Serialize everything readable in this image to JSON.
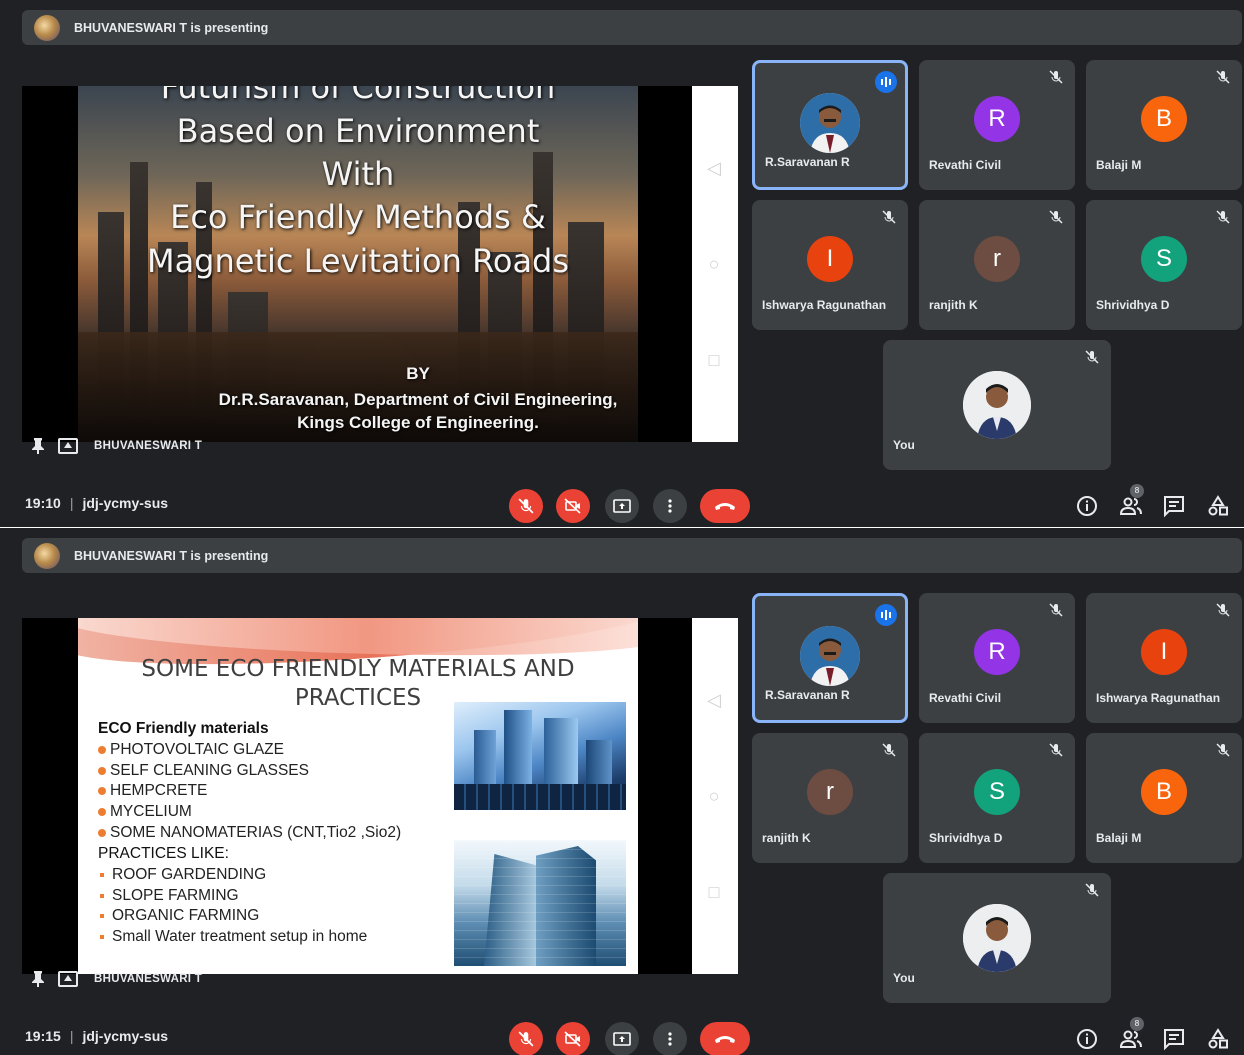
{
  "colors": {
    "accent": "#8ab4f8",
    "danger": "#ea4335",
    "tile_bg": "#3c4043",
    "bg": "#202124",
    "bullet": "#ed7d31"
  },
  "meetings": [
    {
      "presenter_banner": "BHUVANESWARI T is presenting",
      "stage_name": "BHUVANESWARI T",
      "time": "19:10",
      "meeting_code": "jdj-ycmy-sus",
      "people_count": "8",
      "slide": {
        "title_lines": [
          "Futurism of Construction",
          "Based on Environment",
          "With",
          "Eco Friendly Methods &",
          "Magnetic Levitation Roads"
        ],
        "by": "BY",
        "author": "Dr.R.Saravanan, Department of Civil Engineering,",
        "college": "Kings College of Engineering."
      },
      "participants": [
        {
          "name": "R.Saravanan R",
          "initial": "",
          "color": "",
          "icon": "photo-avatar",
          "speaking": true
        },
        {
          "name": "Revathi Civil",
          "initial": "R",
          "color": "#9334e6",
          "icon": "mic-off-icon"
        },
        {
          "name": "Balaji M",
          "initial": "B",
          "color": "#f9650c",
          "icon": "mic-off-icon"
        },
        {
          "name": "Ishwarya Ragunathan",
          "initial": "I",
          "color": "#e8430f",
          "icon": "mic-off-icon"
        },
        {
          "name": "ranjith K",
          "initial": "r",
          "color": "#6d4c41",
          "icon": "mic-off-icon"
        },
        {
          "name": "Shrividhya D",
          "initial": "S",
          "color": "#12a37c",
          "icon": "mic-off-icon"
        }
      ],
      "self": {
        "name": "You",
        "icon": "mic-off-icon"
      }
    },
    {
      "presenter_banner": "BHUVANESWARI T is presenting",
      "stage_name": "BHUVANESWARI T",
      "time": "19:15",
      "meeting_code": "jdj-ycmy-sus",
      "people_count": "8",
      "slide": {
        "title_line1": "SOME ECO FRIENDLY MATERIALS AND",
        "title_line2": "PRACTICES",
        "materials_heading": "ECO Friendly materials",
        "materials": [
          "PHOTOVOLTAIC GLAZE",
          "SELF CLEANING GLASSES",
          "HEMPCRETE",
          "MYCELIUM",
          "SOME NANOMATERIAS (CNT,Tio2 ,Sio2)"
        ],
        "practices_heading": "PRACTICES LIKE:",
        "practices": [
          "ROOF GARDENDING",
          "SLOPE FARMING",
          "ORGANIC FARMING",
          "Small Water treatment setup in home"
        ]
      },
      "participants": [
        {
          "name": "R.Saravanan R",
          "initial": "",
          "color": "",
          "icon": "photo-avatar",
          "speaking": true
        },
        {
          "name": "Revathi Civil",
          "initial": "R",
          "color": "#9334e6",
          "icon": "mic-off-icon"
        },
        {
          "name": "Ishwarya Ragunathan",
          "initial": "I",
          "color": "#e8430f",
          "icon": "mic-off-icon"
        },
        {
          "name": "ranjith K",
          "initial": "r",
          "color": "#6d4c41",
          "icon": "mic-off-icon"
        },
        {
          "name": "Shrividhya D",
          "initial": "S",
          "color": "#12a37c",
          "icon": "mic-off-icon"
        },
        {
          "name": "Balaji M",
          "initial": "B",
          "color": "#f9650c",
          "icon": "mic-off-icon"
        }
      ],
      "self": {
        "name": "You",
        "icon": "mic-off-icon"
      }
    }
  ]
}
